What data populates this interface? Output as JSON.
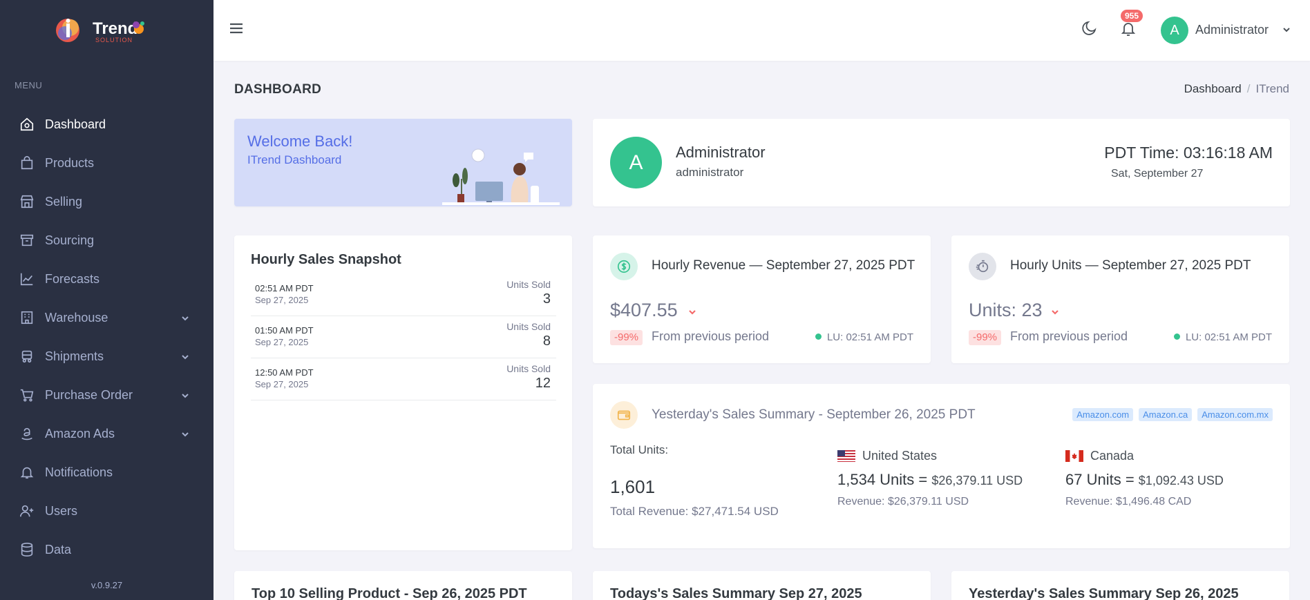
{
  "brand": {
    "logo_text": "Trend",
    "logo_sub": "SOLUTION"
  },
  "sidebar": {
    "menu_title": "MENU",
    "items": [
      {
        "label": "Dashboard",
        "icon": "home-icon",
        "active": true,
        "has_children": false
      },
      {
        "label": "Products",
        "icon": "bag-icon",
        "active": false,
        "has_children": false
      },
      {
        "label": "Selling",
        "icon": "store-icon",
        "active": false,
        "has_children": false
      },
      {
        "label": "Sourcing",
        "icon": "archive-icon",
        "active": false,
        "has_children": false
      },
      {
        "label": "Forecasts",
        "icon": "chart-line-icon",
        "active": false,
        "has_children": false
      },
      {
        "label": "Warehouse",
        "icon": "building-icon",
        "active": false,
        "has_children": true
      },
      {
        "label": "Shipments",
        "icon": "truck-icon",
        "active": false,
        "has_children": true
      },
      {
        "label": "Purchase Order",
        "icon": "cart-icon",
        "active": false,
        "has_children": true
      },
      {
        "label": "Amazon Ads",
        "icon": "amazon-icon",
        "active": false,
        "has_children": true
      },
      {
        "label": "Notifications",
        "icon": "bell-icon",
        "active": false,
        "has_children": false
      },
      {
        "label": "Users",
        "icon": "user-plus-icon",
        "active": false,
        "has_children": false
      },
      {
        "label": "Data",
        "icon": "database-icon",
        "active": false,
        "has_children": false
      }
    ],
    "version": "v.0.9.27"
  },
  "header": {
    "notification_count": "955",
    "user_initial": "A",
    "user_name": "Administrator"
  },
  "page": {
    "title": "DASHBOARD",
    "breadcrumb": [
      "Dashboard",
      "ITrend"
    ]
  },
  "welcome": {
    "title": "Welcome Back!",
    "subtitle": "ITrend Dashboard"
  },
  "profile": {
    "initial": "A",
    "name": "Administrator",
    "role": "administrator",
    "time": "PDT Time: 03:16:18 AM",
    "date": "Sat, September 27"
  },
  "hourly_snapshot": {
    "title": "Hourly Sales Snapshot",
    "rows": [
      {
        "time": "02:51 AM PDT",
        "date": "Sep 27, 2025",
        "label": "Units Sold",
        "value": "3"
      },
      {
        "time": "01:50 AM PDT",
        "date": "Sep 27, 2025",
        "label": "Units Sold",
        "value": "8"
      },
      {
        "time": "12:50 AM PDT",
        "date": "Sep 27, 2025",
        "label": "Units Sold",
        "value": "12"
      }
    ]
  },
  "hourly_revenue": {
    "title": "Hourly Revenue — September 27, 2025 PDT",
    "value": "$407.55",
    "change": "-99%",
    "from_text": "From previous period",
    "lu": "LU: 02:51 AM PDT"
  },
  "hourly_units": {
    "title": "Hourly Units — September 27, 2025 PDT",
    "value": "Units: 23",
    "change": "-99%",
    "from_text": "From previous period",
    "lu": "LU: 02:51 AM PDT"
  },
  "yesterday_summary": {
    "title": "Yesterday's Sales Summary - September 26, 2025 PDT",
    "tags": [
      "Amazon.com",
      "Amazon.ca",
      "Amazon.com.mx"
    ],
    "total_units_label": "Total Units:",
    "total_units_value": "1,601",
    "total_revenue": "Total Revenue: $27,471.54 USD",
    "us": {
      "country": "United States",
      "units": "1,534 Units =",
      "usd": "$26,379.11 USD",
      "revenue": "Revenue: $26,379.11 USD"
    },
    "ca": {
      "country": "Canada",
      "units": "67 Units =",
      "usd": "$1,092.43 USD",
      "revenue": "Revenue: $1,496.48 CAD"
    }
  },
  "bottom_cards": {
    "top10": "Top 10 Selling Product - Sep 26, 2025 PDT",
    "today": "Todays's Sales Summary Sep 27, 2025",
    "yesterday": "Yesterday's Sales Summary Sep 26, 2025"
  },
  "colors": {
    "sidebar_bg": "#2a3042",
    "accent_green": "#34c38f",
    "accent_red": "#f46a6a",
    "accent_blue": "#556ee6",
    "welcome_bg": "#d4dbf9"
  }
}
